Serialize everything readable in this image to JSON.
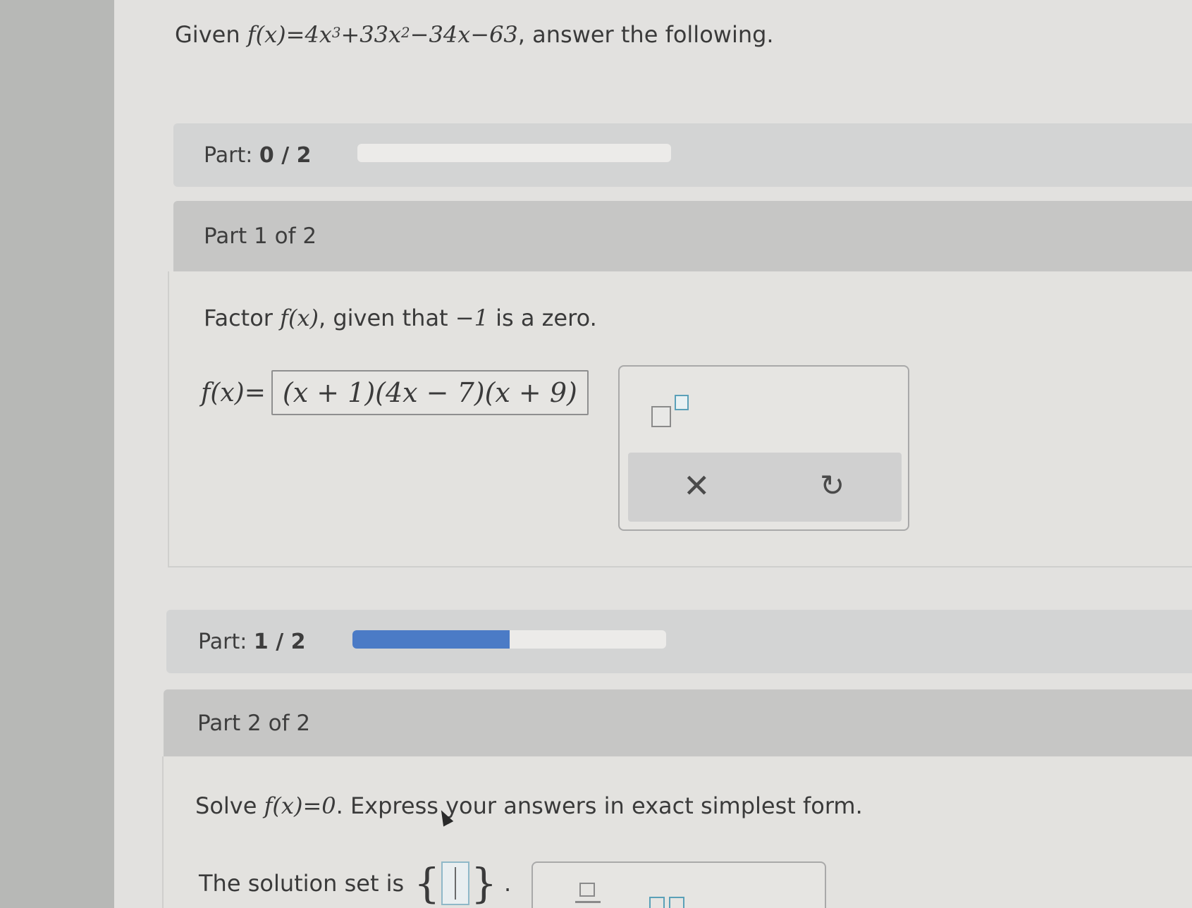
{
  "question": {
    "prefix": "Given ",
    "function_lhs": "f(x)",
    "eq": "=",
    "term1_coef": "4x",
    "term1_exp": "3",
    "term2": "+33x",
    "term2_exp": "2",
    "term3": "−34x−63",
    "suffix": ", answer the following."
  },
  "progress_1": {
    "label": "Part:",
    "value": "0 / 2",
    "fill_fraction": 0.0
  },
  "part1": {
    "header": "Part 1 of 2",
    "prompt_prefix": "Factor ",
    "prompt_fx": "f(x)",
    "prompt_mid": ", given that ",
    "prompt_zero": "−1",
    "prompt_suffix": " is a zero.",
    "answer_lhs": "f(x)=",
    "answer_value": "(x + 1)(4x − 7)(x + 9)"
  },
  "toolbox1": {
    "clear_glyph": "✕",
    "undo_glyph": "↻"
  },
  "progress_2": {
    "label": "Part:",
    "value": "1 / 2",
    "fill_fraction": 0.5
  },
  "part2": {
    "header": "Part 2 of 2",
    "prompt_prefix": "Solve ",
    "prompt_eq": "f(x)=0",
    "prompt_suffix": ". Express your answers in exact simplest form.",
    "solution_label": "The solution set is",
    "open_brace": "{",
    "close_brace": "}",
    "period": "."
  },
  "colors": {
    "progress_fill": "#4b7bc6",
    "accent_box": "#5aa0b8"
  }
}
